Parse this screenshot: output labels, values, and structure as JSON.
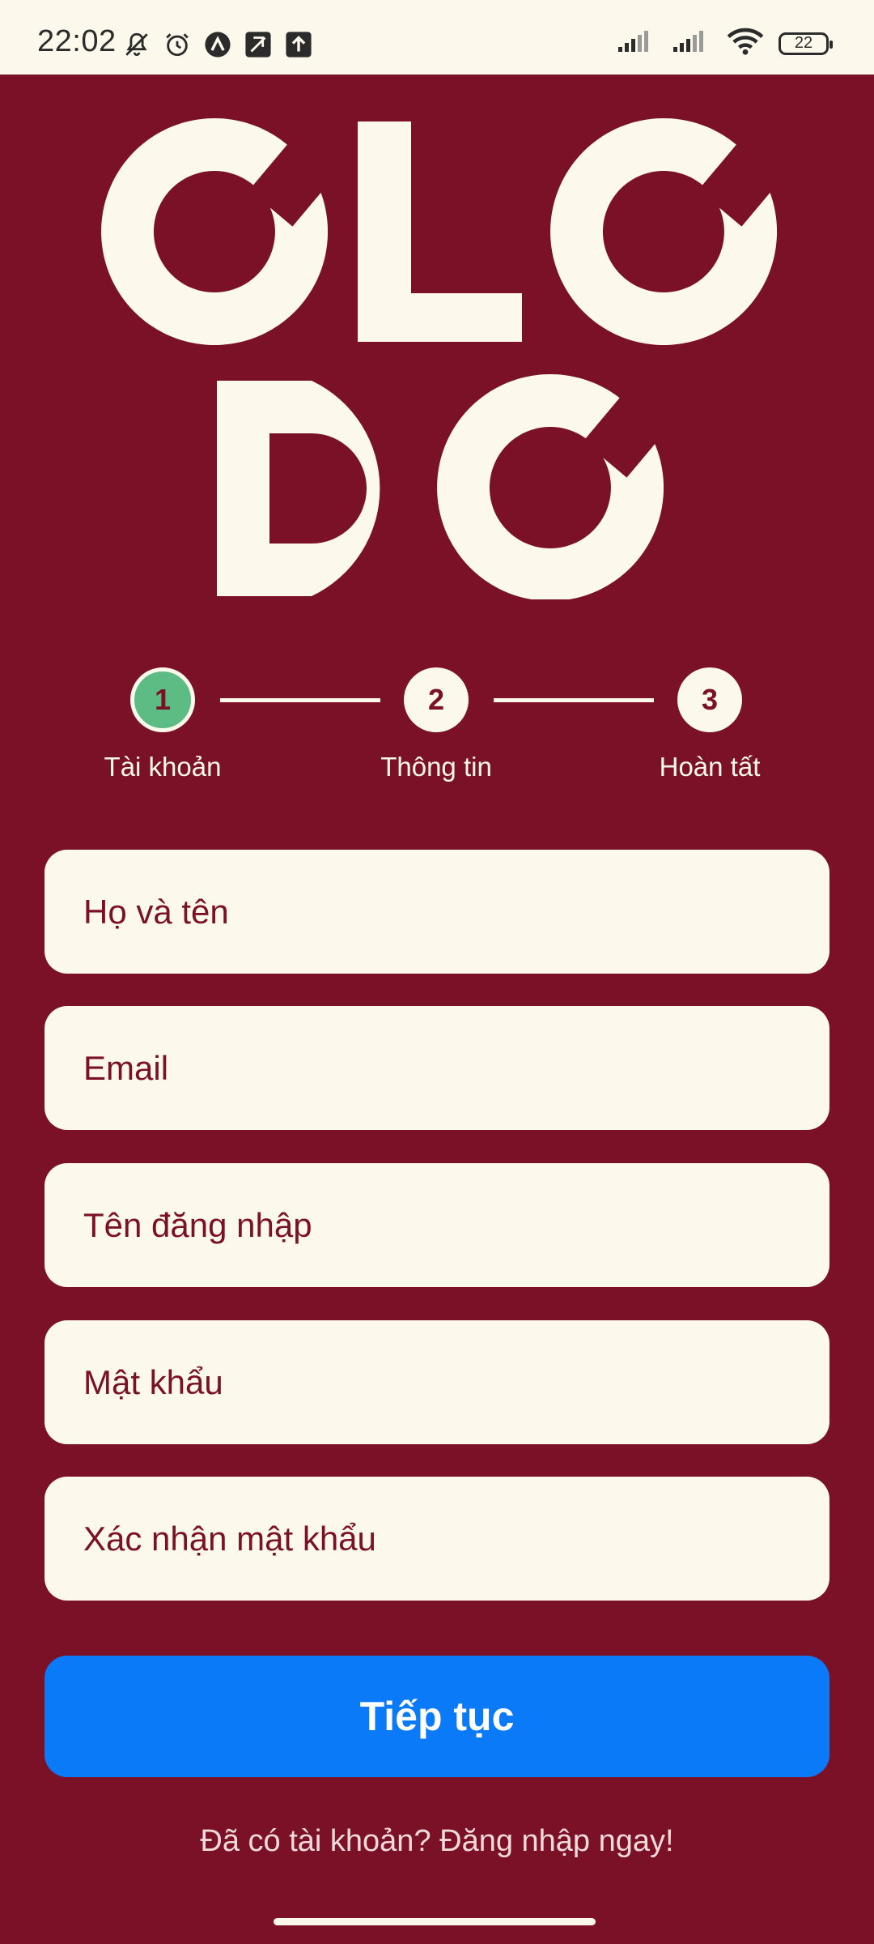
{
  "status_bar": {
    "time": "22:02",
    "battery": "22"
  },
  "logo": {
    "line1": "OLO",
    "line2": "DO"
  },
  "stepper": {
    "steps": [
      {
        "number": "1",
        "label": "Tài khoản",
        "state": "active"
      },
      {
        "number": "2",
        "label": "Thông tin",
        "state": "pending"
      },
      {
        "number": "3",
        "label": "Hoàn tất",
        "state": "pending"
      }
    ]
  },
  "form": {
    "fields": [
      {
        "placeholder": "Họ và tên",
        "value": ""
      },
      {
        "placeholder": "Email",
        "value": ""
      },
      {
        "placeholder": "Tên đăng nhập",
        "value": ""
      },
      {
        "placeholder": "Mật khẩu",
        "value": ""
      },
      {
        "placeholder": "Xác nhận mật khẩu",
        "value": ""
      }
    ],
    "submit_label": "Tiếp tục",
    "login_link": "Đã có tài khoản? Đăng nhập ngay!"
  },
  "colors": {
    "background": "#7a1126",
    "cream": "#fcf8ec",
    "active_step": "#5cbc84",
    "primary_button": "#0a7af8"
  }
}
